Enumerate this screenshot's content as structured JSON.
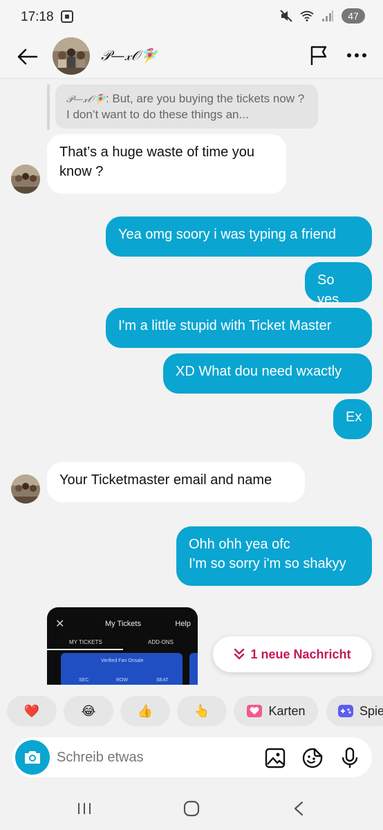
{
  "status_bar": {
    "time": "17:18",
    "battery": "47",
    "icons": [
      "screenshot-icon",
      "mute-icon",
      "wifi-icon",
      "signal-icon",
      "battery-icon"
    ]
  },
  "header": {
    "contact_name": "𝒫—𝓍𝒪🧚‍♀️",
    "icons": [
      "back-arrow-icon",
      "flag-icon",
      "more-dots-icon"
    ]
  },
  "chat": {
    "quote": {
      "name": "𝒫—𝓍𝒪🧚‍♀️",
      "text": ": But, are you buying the tickets now ? I don’t want to do these things an..."
    },
    "messages": [
      {
        "side": "in",
        "text": "That’s a huge waste of time you know ?"
      },
      {
        "side": "out",
        "text": "Yea omg soory i was typing a friend"
      },
      {
        "side": "out",
        "text": "So yes"
      },
      {
        "side": "out",
        "text": "I'm a little stupid with Ticket Master"
      },
      {
        "side": "out",
        "text": "XD What dou need wxactly"
      },
      {
        "side": "out",
        "text": "Ex"
      },
      {
        "side": "in",
        "text": "Your Ticketmaster email and name"
      },
      {
        "side": "out",
        "text": "Ohh ohh yea ofc\nI'm so sorry i'm so shakyy"
      }
    ],
    "image_preview": {
      "title": "My Tickets",
      "help": "Help",
      "tab_1": "MY TICKETS",
      "tab_2": "ADD-ONS",
      "ticket_header": "Verified Fan Onsale",
      "sec": "SEC",
      "row": "ROW",
      "seat": "SEAT"
    },
    "new_message_pill": "1 neue Nachricht"
  },
  "reactions": [
    {
      "emoji": "❤️",
      "name": "heart"
    },
    {
      "emoji": "😂",
      "name": "laughing"
    },
    {
      "emoji": "👍",
      "name": "thumbs-up"
    },
    {
      "emoji": "👆",
      "name": "pointing-up"
    },
    {
      "label": "Karten",
      "icon": "cards-icon"
    },
    {
      "label": "Spie",
      "icon": "gamepad-icon"
    }
  ],
  "composer": {
    "placeholder": "Schreib etwas"
  },
  "colors": {
    "outgoing_bubble": "#0aa5d1",
    "incoming_bubble": "#ffffff",
    "background": "#f2f2f2",
    "accent_pink": "#c2185b"
  }
}
